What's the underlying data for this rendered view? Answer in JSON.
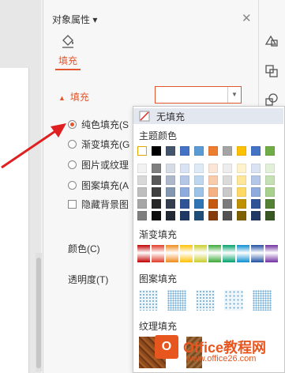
{
  "pane": {
    "title": "对象属性 ▾",
    "close_glyph": "✕",
    "tab_fill": "填充"
  },
  "fill_section": {
    "title": "填充",
    "options": [
      "纯色填充(S",
      "渐变填充(G",
      "图片或纹理",
      "图案填充(A"
    ],
    "selected": 0,
    "hide_bg_label": "隐藏背景图"
  },
  "properties": {
    "color_label": "颜色(C)",
    "transparency_label": "透明度(T)"
  },
  "popup": {
    "no_fill": "无填充",
    "theme_colors": "主题颜色",
    "gradient_fill": "渐变填充",
    "pattern_fill": "图案填充",
    "texture_fill": "纹理填充",
    "theme_top_row": [
      "#ffffff",
      "#000000",
      "#44546a",
      "#4472c4",
      "#5b9bd5",
      "#ed7d31",
      "#a5a5a5",
      "#ffc000",
      "#4472c4",
      "#70ad47"
    ],
    "theme_shades": [
      [
        "#f2f2f2",
        "#7f7f7f",
        "#d6dce5",
        "#dae3f3",
        "#deebf7",
        "#fbe5d6",
        "#ededed",
        "#fff2cc",
        "#dae3f3",
        "#e2f0d9"
      ],
      [
        "#d9d9d9",
        "#595959",
        "#adb9ca",
        "#b4c7e7",
        "#bdd7ee",
        "#f8cbad",
        "#dbdbdb",
        "#ffe699",
        "#b4c7e7",
        "#c5e0b4"
      ],
      [
        "#bfbfbf",
        "#404040",
        "#8497b0",
        "#8faadc",
        "#9dc3e6",
        "#f4b183",
        "#c9c9c9",
        "#ffd966",
        "#8faadc",
        "#a9d18e"
      ],
      [
        "#a6a6a6",
        "#262626",
        "#333f50",
        "#2f5597",
        "#2e75b6",
        "#c55a11",
        "#7b7b7b",
        "#bf9000",
        "#2f5597",
        "#548235"
      ],
      [
        "#7f7f7f",
        "#0d0d0d",
        "#222a35",
        "#203864",
        "#1f4e79",
        "#843c0c",
        "#525252",
        "#7f6000",
        "#203864",
        "#385723"
      ]
    ],
    "gradient_colors": [
      "#c00000",
      "#e03a2a",
      "#f08a1a",
      "#ffc000",
      "#c9cd2a",
      "#3aa835",
      "#00a06a",
      "#0a8fd0",
      "#1f4ea0",
      "#7030a0"
    ]
  },
  "watermark": {
    "main": "Office教程网",
    "sub": "www.office26.com",
    "logo_letter": "O"
  }
}
